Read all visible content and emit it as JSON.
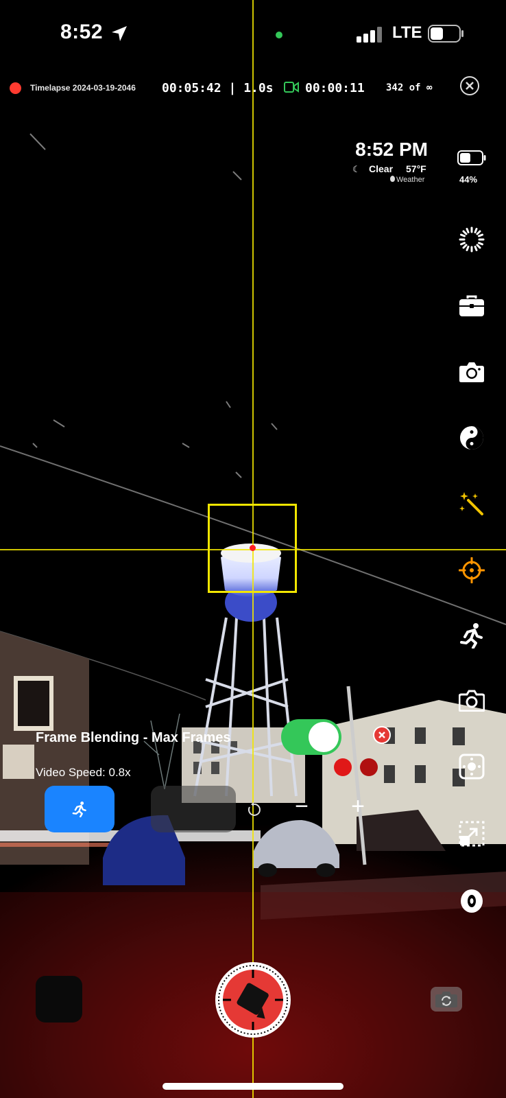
{
  "status_bar": {
    "time": "8:52",
    "network": "LTE"
  },
  "recording": {
    "name": "Timelapse 2024-03-19-2046",
    "elapsed_interval": "00:05:42 | 1.0s",
    "video_length": "00:00:11",
    "frame_count": "342 of ∞"
  },
  "widget": {
    "time": "8:52 PM",
    "condition": "Clear",
    "temperature": "57°F",
    "weather_source": "Weather",
    "battery_percent": "44%"
  },
  "overlay": {
    "frame_blending_label": "Frame Blending - Max Frames",
    "frame_blending_enabled": true,
    "video_speed_label": "Video Speed: 0.8x",
    "minus": "−",
    "plus": "+"
  },
  "colors": {
    "accent_yellow": "#f2e600",
    "record_red": "#ff3b30",
    "toggle_green": "#34c759",
    "button_blue": "#1a84ff",
    "focus_orange": "#ff9500"
  },
  "right_rail_icons": [
    "battery-icon",
    "aperture-icon",
    "toolbox-icon",
    "camera-icon",
    "yin-yang-icon",
    "magic-wand-icon",
    "focus-crosshair-icon",
    "running-person-icon",
    "camera-mode-icon",
    "focus-frame-icon",
    "resize-icon",
    "stabilization-icon"
  ]
}
